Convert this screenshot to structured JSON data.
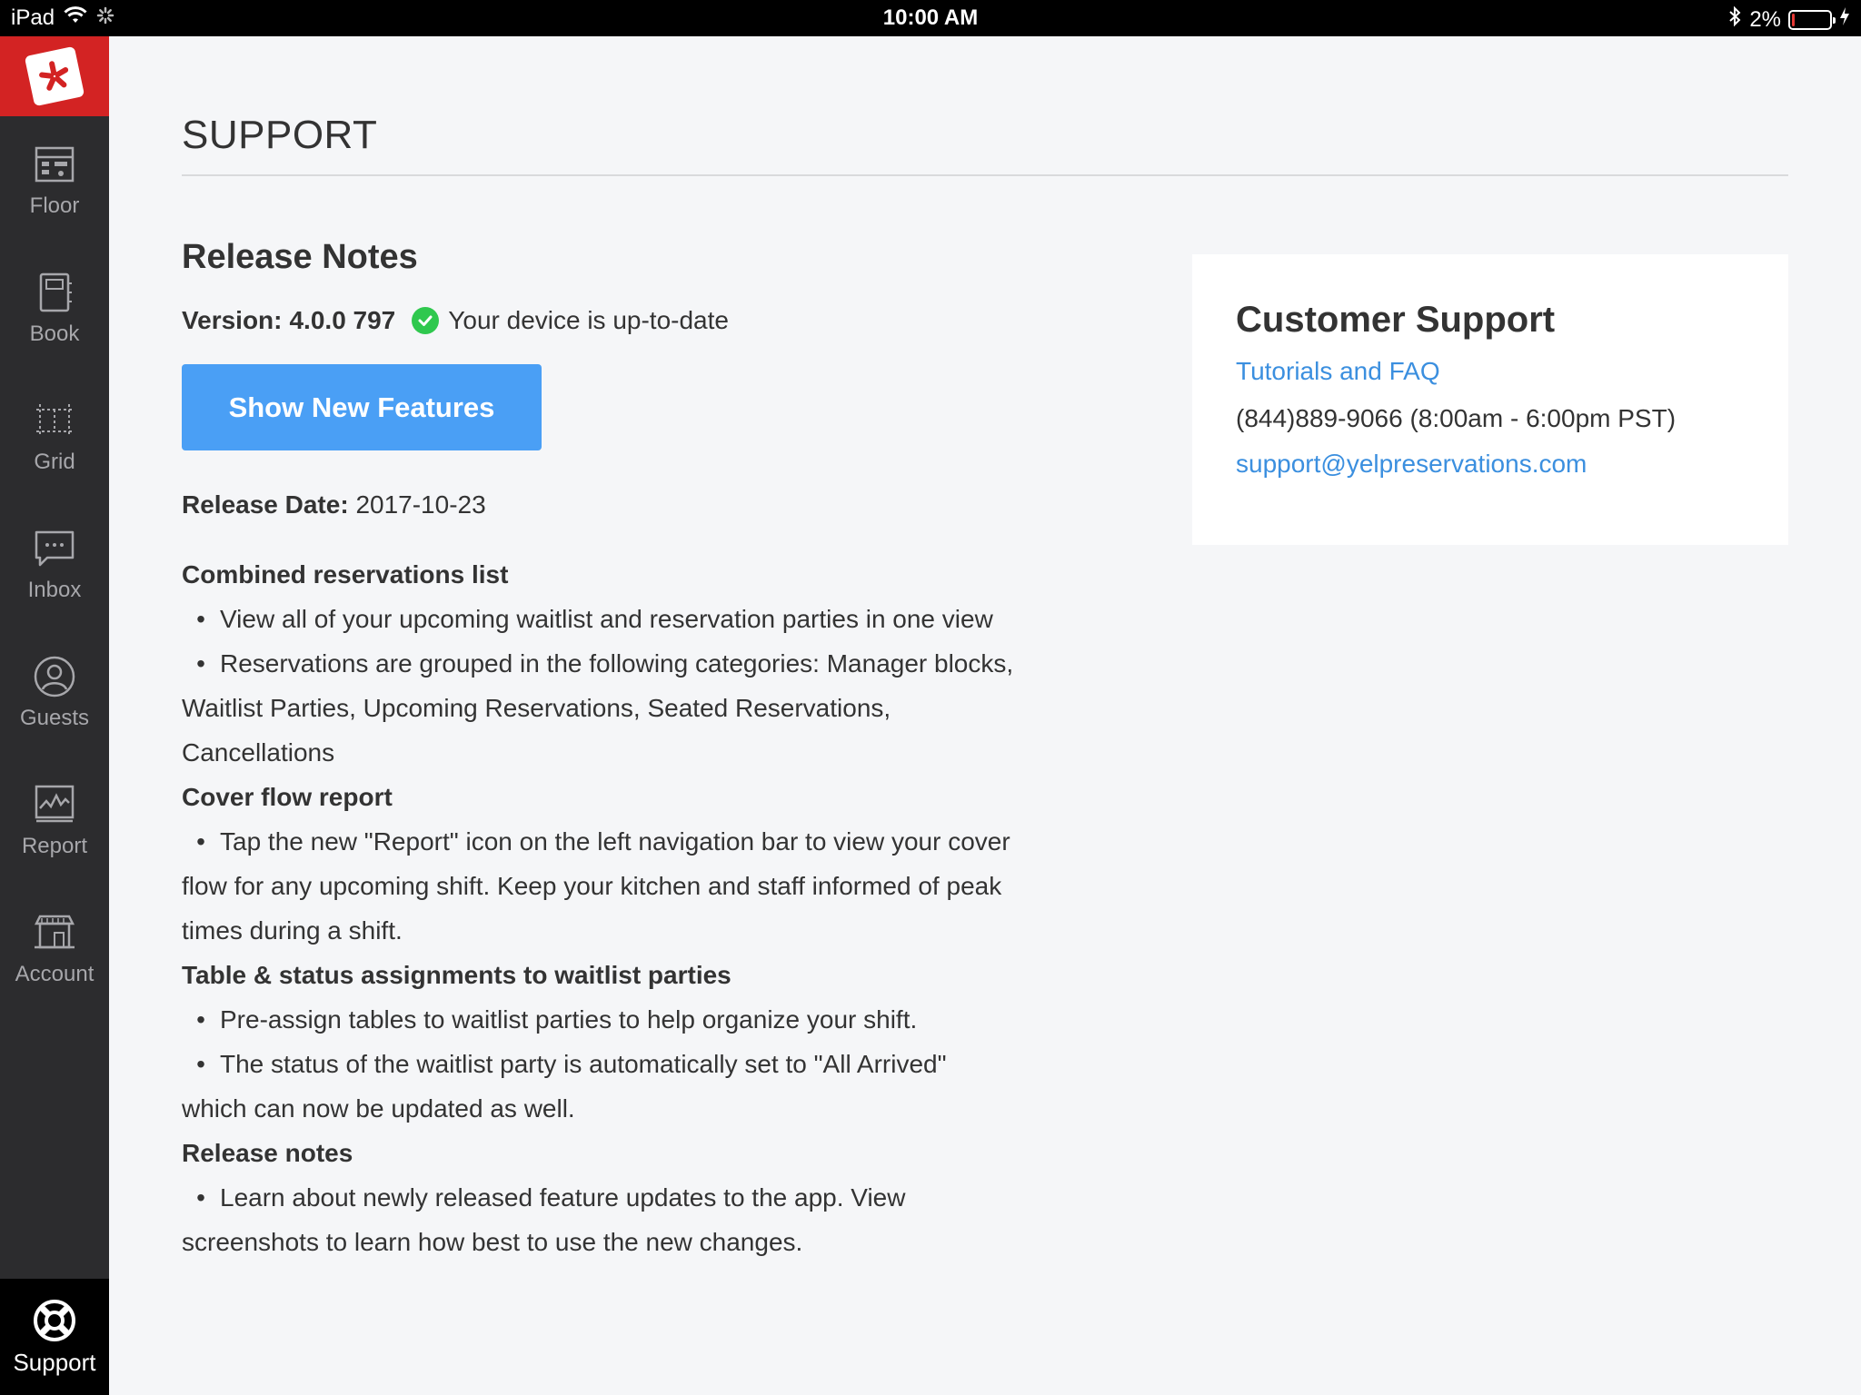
{
  "status_bar": {
    "device": "iPad",
    "time": "10:00 AM",
    "battery": "2%"
  },
  "sidebar": {
    "items": [
      {
        "label": "Floor",
        "icon": "floor-icon"
      },
      {
        "label": "Book",
        "icon": "book-icon"
      },
      {
        "label": "Grid",
        "icon": "grid-icon"
      },
      {
        "label": "Inbox",
        "icon": "inbox-icon"
      },
      {
        "label": "Guests",
        "icon": "guests-icon"
      },
      {
        "label": "Report",
        "icon": "report-icon"
      },
      {
        "label": "Account",
        "icon": "account-icon"
      }
    ],
    "active": {
      "label": "Support",
      "icon": "lifebuoy-icon"
    }
  },
  "page": {
    "title": "SUPPORT"
  },
  "release": {
    "heading": "Release Notes",
    "version_label": "Version:",
    "version": "4.0.0 797",
    "up_to_date": "Your device is up-to-date",
    "button": "Show New Features",
    "date_label": "Release Date:",
    "date": "2017-10-23",
    "sections": [
      {
        "title": "Combined reservations list",
        "bullets": [
          {
            "text": "View all of your upcoming waitlist and reservation parties in one view",
            "cont": []
          },
          {
            "text": "Reservations are grouped in the following categories: Manager blocks,",
            "cont": [
              "Waitlist Parties, Upcoming Reservations, Seated Reservations,",
              "Cancellations"
            ]
          }
        ]
      },
      {
        "title": "Cover flow report",
        "bullets": [
          {
            "text": "Tap the new \"Report\" icon on the left navigation bar to view your cover",
            "cont": [
              "flow for any upcoming shift. Keep your kitchen and staff informed of peak",
              "times during a shift."
            ]
          }
        ]
      },
      {
        "title": "Table & status assignments to waitlist parties",
        "bullets": [
          {
            "text": "Pre-assign tables to waitlist parties to help organize your shift.",
            "cont": []
          },
          {
            "text": "The status of the waitlist party is automatically set to \"All Arrived\"",
            "cont": [
              "which can now be updated as well."
            ]
          }
        ]
      },
      {
        "title": "Release notes",
        "bullets": [
          {
            "text": "Learn about newly released feature updates to the app. View",
            "cont": [
              "screenshots to learn how best to use the new changes."
            ]
          }
        ]
      }
    ]
  },
  "support": {
    "title": "Customer Support",
    "faq_link": "Tutorials and FAQ",
    "phone": "(844)889-9066 (8:00am - 6:00pm PST)",
    "email": "support@yelpreservations.com"
  },
  "colors": {
    "brand": "#d32323",
    "sidebar": "#2c2c2e",
    "button": "#4a9ff5",
    "link": "#3b8fdf",
    "success": "#2fc84e"
  }
}
